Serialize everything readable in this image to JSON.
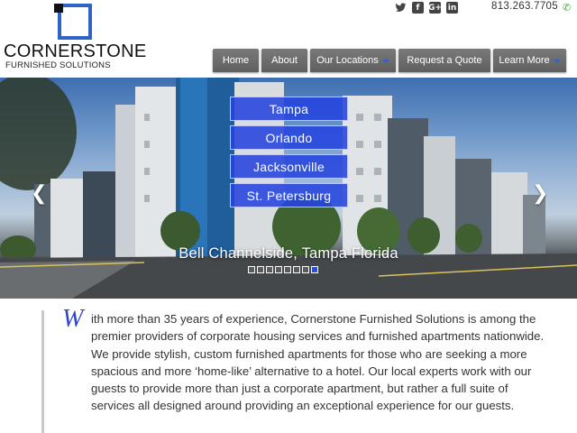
{
  "brand": {
    "name": "CORNERSTONE",
    "tagline": "FURNISHED SOLUTIONS",
    "accent": "#2f63c7"
  },
  "header": {
    "social": [
      "twitter-icon",
      "facebook-icon",
      "google-plus-icon",
      "linkedin-icon"
    ],
    "social_glyphs": {
      "twitter": "🐦",
      "facebook": "f",
      "google": "G+",
      "linkedin": "in"
    },
    "phone": "813.263.7705"
  },
  "nav": {
    "items": [
      {
        "label": "Home",
        "dropdown": false
      },
      {
        "label": "About",
        "dropdown": false
      },
      {
        "label": "Our Locations",
        "dropdown": true
      },
      {
        "label": "Request a Quote",
        "dropdown": false
      },
      {
        "label": "Learn More",
        "dropdown": true
      }
    ]
  },
  "hero": {
    "locations": [
      "Tampa",
      "Orlando",
      "Jacksonville",
      "St. Petersburg"
    ],
    "caption": "Bell Channelside, Tampa Florida",
    "slide_count": 8,
    "active_slide": 8,
    "prev_glyph": "❮",
    "next_glyph": "❯"
  },
  "intro": {
    "dropcap": "W",
    "text": "ith more than 35 years of experience, Cornerstone Furnished Solutions is among the premier providers of corporate housing services and furnished apartments nationwide. We provide stylish, custom furnished apartments for those who are seeking a more spacious and more ‘home-like’ alternative to a hotel. Our local experts work with our guests to provide more than just a corporate apartment, but rather a full suite of services all designed around providing an exceptional experience for our guests."
  }
}
